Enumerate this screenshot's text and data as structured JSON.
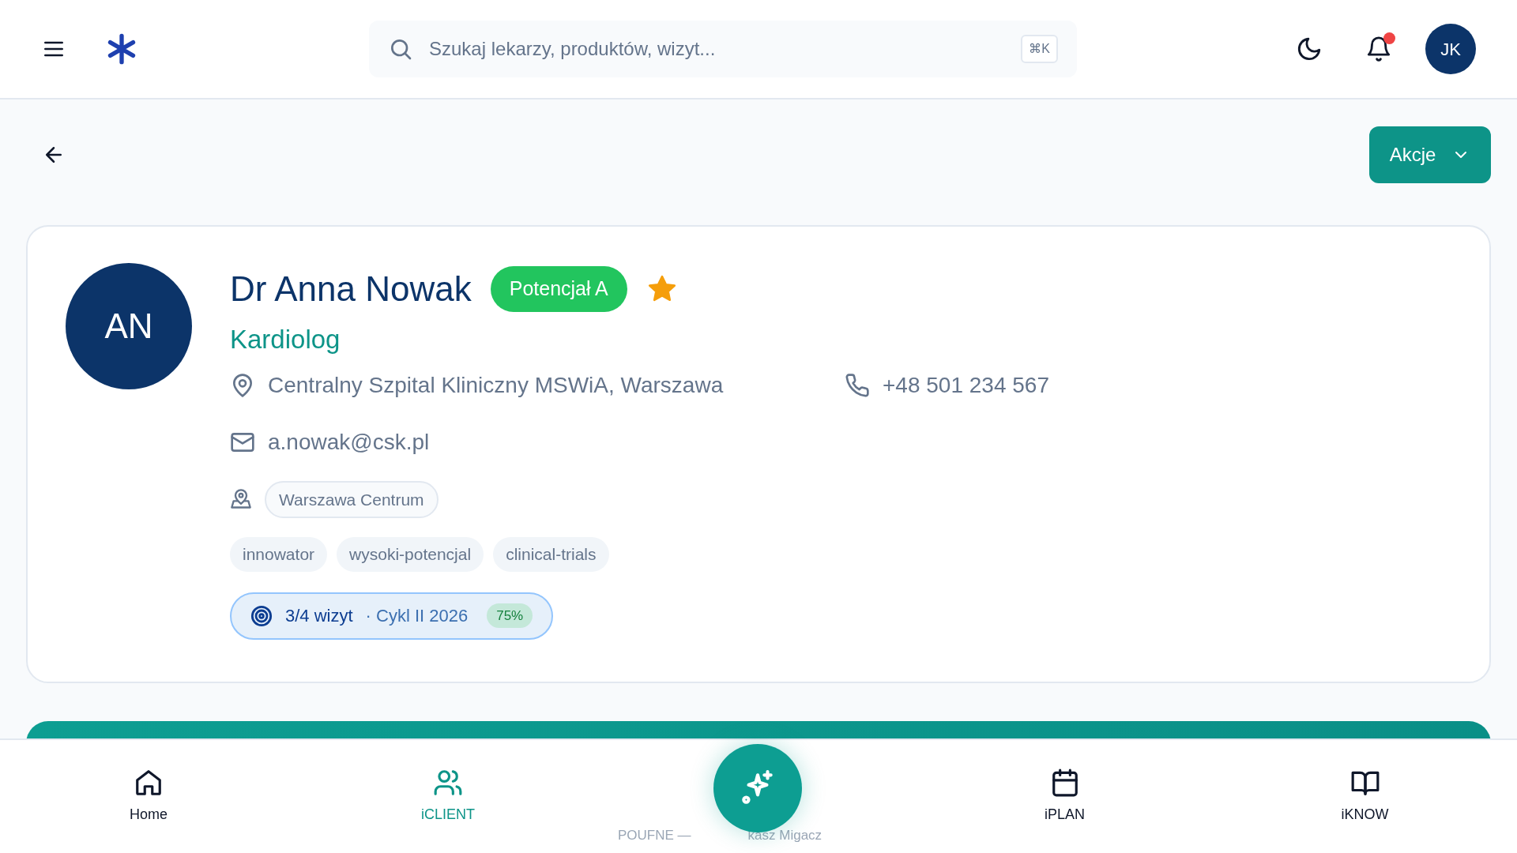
{
  "search": {
    "placeholder": "Szukaj lekarzy, produktów, wizyt...",
    "shortcut": "⌘K"
  },
  "notifications": {
    "unread": true
  },
  "user": {
    "initials": "JK"
  },
  "actions_button": "Akcje",
  "doctor": {
    "initials": "AN",
    "name": "Dr Anna Nowak",
    "badge": "Potencjał A",
    "favorite": true,
    "specialty": "Kardiolog",
    "hospital": "Centralny Szpital Kliniczny MSWiA, Warszawa",
    "phone": "+48 501 234 567",
    "email": "a.nowak@csk.pl",
    "territory": "Warszawa Centrum",
    "tags": [
      "innowator",
      "wysoki-potencjal",
      "clinical-trials"
    ],
    "visits": {
      "count": "3/4 wizyt",
      "cycle": "· Cykl II 2026",
      "percent": "75%"
    }
  },
  "watermark": [
    "POUFNE —",
    "kasz Migacz"
  ],
  "nav": [
    {
      "label": "Home",
      "selected": false
    },
    {
      "label": "iCLIENT",
      "selected": true
    },
    {
      "label": "iPLAN",
      "selected": false
    },
    {
      "label": "iKNOW",
      "selected": false
    }
  ]
}
